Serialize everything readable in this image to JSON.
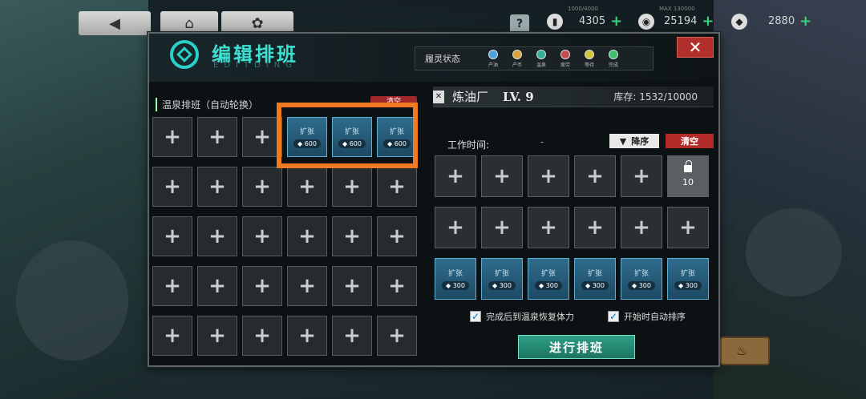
{
  "topbar": {
    "buttons": [
      "back",
      "home",
      "menu"
    ],
    "help": "?",
    "resources": [
      {
        "cap": "1000/4000",
        "value": "4305"
      },
      {
        "cap": "MAX 130000",
        "value": "25194"
      },
      {
        "cap": "",
        "value": "2880"
      }
    ]
  },
  "panel": {
    "title": "编辑排班",
    "subtitle": "EDITDING",
    "close": "✕",
    "status": {
      "label": "履灵状态",
      "items": [
        {
          "label": "产油",
          "color": "#4aa3e0"
        },
        {
          "label": "产币",
          "color": "#d9a23a"
        },
        {
          "label": "温泉",
          "color": "#32b09a"
        },
        {
          "label": "疲劳",
          "color": "#c74a4a"
        },
        {
          "label": "等待",
          "color": "#d4c23a"
        },
        {
          "label": "完成",
          "color": "#3fbf6a"
        }
      ]
    }
  },
  "left": {
    "label": "温泉排班（自动轮换）",
    "clear": "清空",
    "expand_label": "扩张",
    "expand_cost": "600",
    "plus": "+"
  },
  "right": {
    "facility": "炼油厂",
    "level": "LV. 9",
    "stock": "库存:  1532/10000",
    "work_time_label": "工作时间:",
    "work_time_value": "-",
    "sort": "降序",
    "clear": "清空",
    "lock_value": "10",
    "expand_label": "扩张",
    "expand_cost": "300",
    "plus": "+",
    "check1": "完成后到温泉恢复体力",
    "check2": "开始时自动排序",
    "go": "进行排班"
  }
}
